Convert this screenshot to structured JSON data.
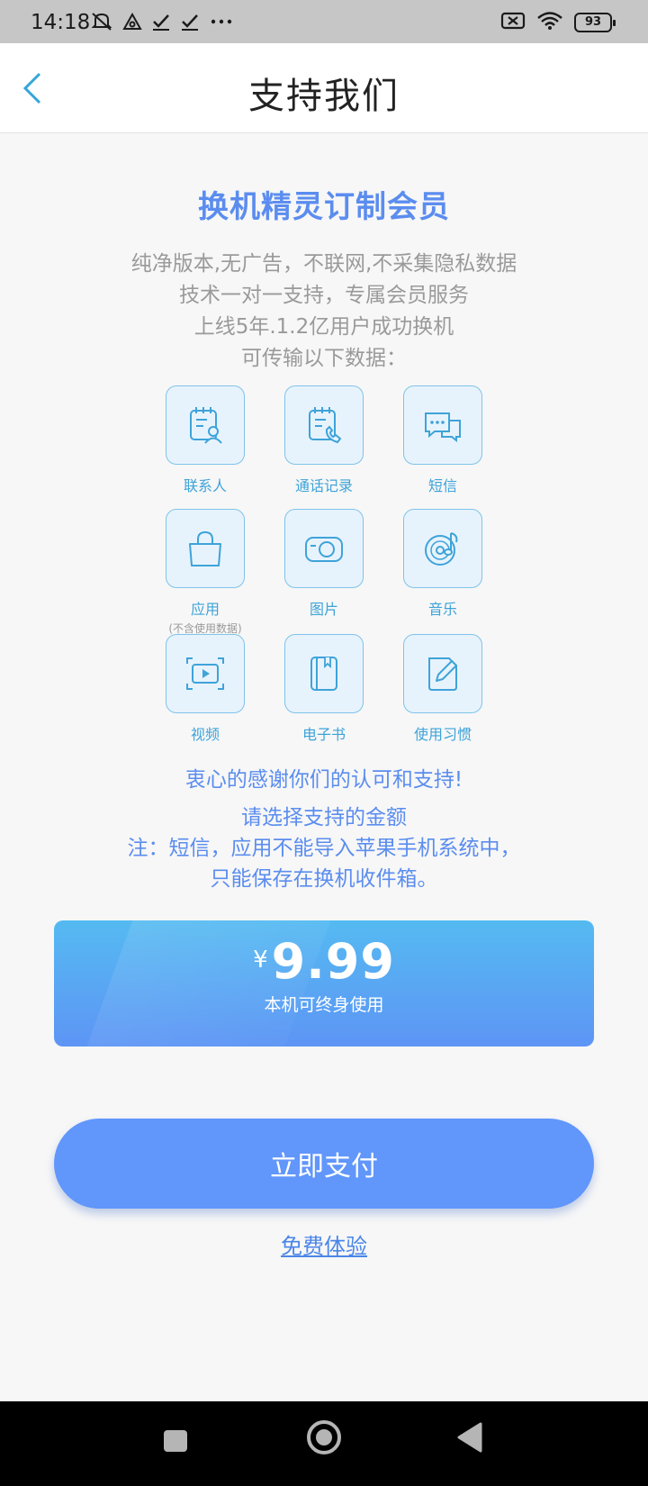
{
  "status_bar": {
    "time": "14:18",
    "battery": "93",
    "icons": [
      "mute-icon",
      "vpn-icon",
      "check-icon",
      "check-icon",
      "more-icon",
      "sim-icon",
      "wifi-icon",
      "battery-icon"
    ]
  },
  "nav": {
    "title": "支持我们",
    "back_icon": "chevron-left-icon"
  },
  "main": {
    "heading": "换机精灵订制会员",
    "desc_lines": [
      "纯净版本,无广告，不联网,不采集隐私数据",
      "技术一对一支持，专属会员服务",
      "上线5年.1.2亿用户成功换机",
      "可传输以下数据："
    ],
    "data_types": [
      {
        "label": "联系人",
        "icon": "contacts-icon"
      },
      {
        "label": "通话记录",
        "icon": "call-log-icon"
      },
      {
        "label": "短信",
        "icon": "sms-icon"
      },
      {
        "label": "应用",
        "sub": "(不含使用数据)",
        "icon": "app-bag-icon"
      },
      {
        "label": "图片",
        "icon": "camera-icon"
      },
      {
        "label": "音乐",
        "icon": "music-icon"
      },
      {
        "label": "视频",
        "icon": "video-icon"
      },
      {
        "label": "电子书",
        "icon": "ebook-icon"
      },
      {
        "label": "使用习惯",
        "icon": "edit-icon"
      }
    ],
    "thanks": "衷心的感谢你们的认可和支持!",
    "note_lines": [
      "请选择支持的金额",
      "注：短信，应用不能导入苹果手机系统中，",
      "只能保存在换机收件箱。"
    ]
  },
  "price": {
    "currency": "¥",
    "amount": "9.99",
    "caption": "本机可终身使用"
  },
  "actions": {
    "pay_label": "立即支付",
    "trial_label": "免费体验"
  },
  "colors": {
    "accent": "#5b8def",
    "tile_border": "#7fc3ea",
    "tile_bg": "#e7f3fc",
    "button": "#6196fb"
  }
}
